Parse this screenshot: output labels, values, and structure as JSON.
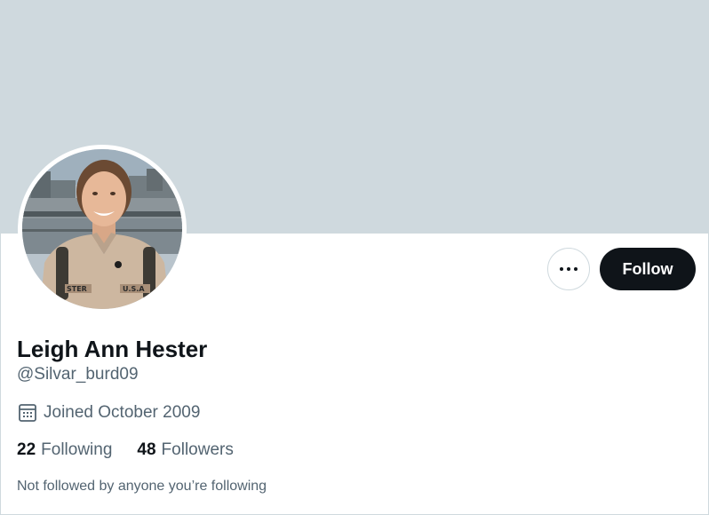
{
  "profile": {
    "name": "Leigh Ann Hester",
    "handle": "@Silvar_burd09",
    "joined": "Joined October 2009",
    "following_count": "22",
    "following_label": "Following",
    "followers_count": "48",
    "followers_label": "Followers",
    "mutual_note": "Not followed by anyone you’re following",
    "avatar_uniform_text_left": "STER",
    "avatar_uniform_text_right": "U.S.A"
  },
  "actions": {
    "follow_label": "Follow",
    "more_icon": "more-horizontal-icon"
  },
  "icons": {
    "joined": "calendar-icon"
  },
  "colors": {
    "banner": "#cfd9de",
    "primary_text": "#0f1419",
    "secondary_text": "#536471",
    "follow_bg": "#0f1419",
    "follow_text": "#ffffff",
    "border": "#cfd9de"
  }
}
